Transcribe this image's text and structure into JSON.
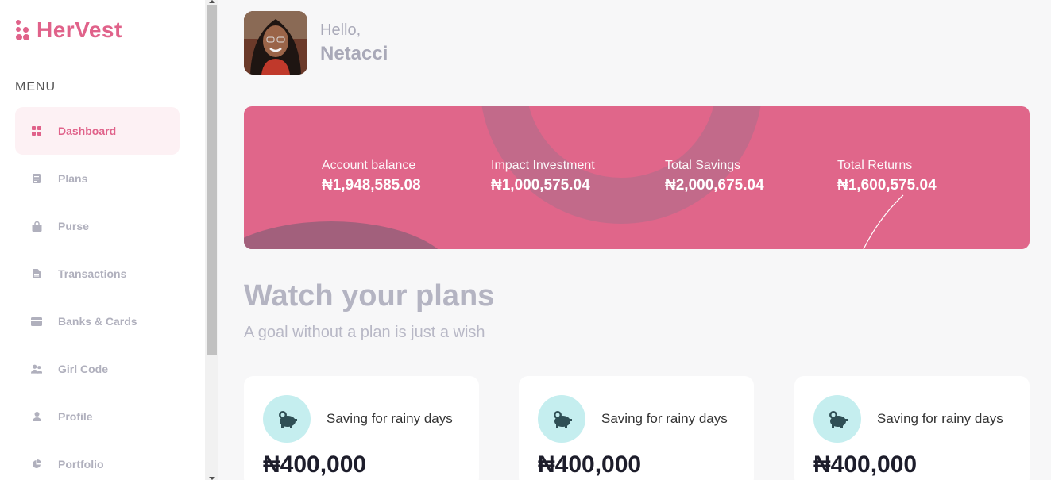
{
  "brand": {
    "name": "HerVest",
    "color": "#e0628a"
  },
  "sidebar": {
    "menu_label": "MENU",
    "items": [
      {
        "label": "Dashboard",
        "icon": "grid-icon",
        "active": true
      },
      {
        "label": "Plans",
        "icon": "document-icon"
      },
      {
        "label": "Purse",
        "icon": "bag-icon"
      },
      {
        "label": "Transactions",
        "icon": "file-icon"
      },
      {
        "label": "Banks & Cards",
        "icon": "card-icon"
      },
      {
        "label": "Girl Code",
        "icon": "users-icon"
      },
      {
        "label": "Profile",
        "icon": "user-icon"
      },
      {
        "label": "Portfolio",
        "icon": "pie-chart-icon"
      }
    ]
  },
  "header": {
    "greeting": "Hello,",
    "username": "Netacci"
  },
  "summary": {
    "account_balance": {
      "label": "Account balance",
      "value": "₦1,948,585.08"
    },
    "impact_investment": {
      "label": "Impact Investment",
      "value": "₦1,000,575.04"
    },
    "total_savings": {
      "label": "Total Savings",
      "value": "₦2,000,675.04"
    },
    "total_returns": {
      "label": "Total Returns",
      "value": "₦1,600,575.04"
    }
  },
  "plans": {
    "title": "Watch your plans",
    "subtitle": "A goal without a plan is just a wish",
    "cards": [
      {
        "name": "Saving for rainy days",
        "amount": "₦400,000",
        "icon": "piggy-bank-icon"
      },
      {
        "name": "Saving for rainy days",
        "amount": "₦400,000",
        "icon": "piggy-bank-icon"
      },
      {
        "name": "Saving for rainy days",
        "amount": "₦400,000",
        "icon": "piggy-bank-icon"
      }
    ]
  },
  "colors": {
    "primary": "#e0628a",
    "banner": "#e0668a",
    "plan_icon_bg": "#c5eeef",
    "plan_icon": "#2f4f55"
  }
}
